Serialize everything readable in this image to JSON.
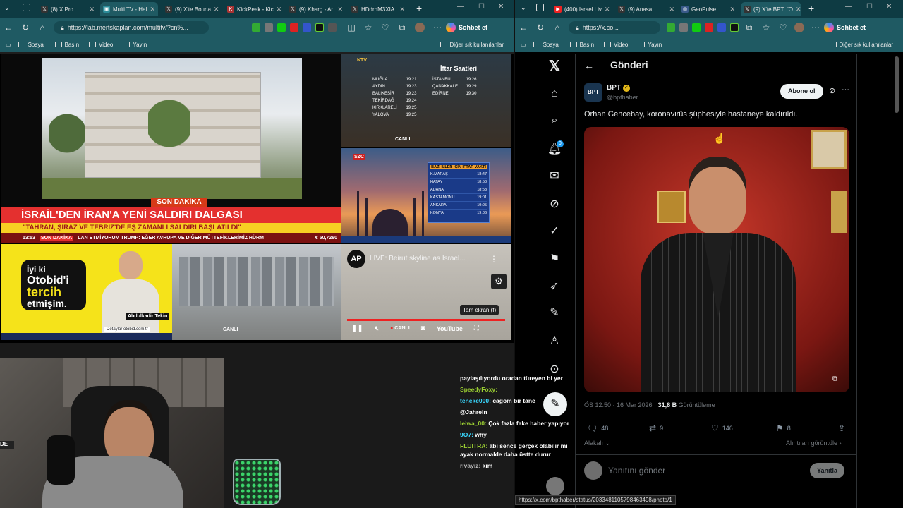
{
  "left_window": {
    "tabs": [
      {
        "label": "(8) X Pro",
        "active": false
      },
      {
        "label": "Multi TV - Hal",
        "active": true
      },
      {
        "label": "(9) X'te Bouna",
        "active": false
      },
      {
        "label": "KickPeek - Kic",
        "active": false
      },
      {
        "label": "(9) Kharg - Ar",
        "active": false
      },
      {
        "label": "HDdrhM3XIA",
        "active": false
      }
    ],
    "url": "https://lab.mertskaplan.com/multitv/?cn%...",
    "bookmarks": [
      "Sosyal",
      "Basın",
      "Video",
      "Yayın"
    ],
    "other_bookmarks": "Diğer sık kullanılanlar",
    "chat_button": "Sohbet et"
  },
  "right_window": {
    "tabs": [
      {
        "label": "(400) Israel Liv",
        "active": false
      },
      {
        "label": "(9) Anasa",
        "active": false
      },
      {
        "label": "GeoPulse",
        "active": false
      },
      {
        "label": "(9) X'te BPT: \"O",
        "active": true
      }
    ],
    "url": "https://x.co...",
    "bookmarks": [
      "Sosyal",
      "Basın",
      "Video",
      "Yayın"
    ],
    "other_bookmarks": "Diğer sık kullanılanlar",
    "chat_button": "Sohbet et",
    "status_url": "https://x.com/bpthaber/status/2033481105798463498/photo/1"
  },
  "tv": {
    "breaking_tag": "SON DAKİKA",
    "headline": "İSRAİL'DEN İRAN'A YENİ SALDIRI DALGASI",
    "subheadline": "\"TAHRAN, ŞİRAZ VE TEBRİZ'DE EŞ ZAMANLI SALDIRI BAŞLATILDI\"",
    "ticker_time": "13:53",
    "ticker_tag": "SON DAKİKA",
    "ticker_text": "LAN ETMİYORUM   TRUMP: EĞER AVRUPA VE DİĞER MÜTTEFİKLERİMİZ HÜRM",
    "ticker_value": "€ 50,7260",
    "iftar_title": "İftar Saatleri",
    "iftar_rows": [
      [
        "MUĞLA",
        "19:21",
        "İSTANBUL",
        "19:26"
      ],
      [
        "AYDIN",
        "19:23",
        "ÇANAKKALE",
        "19:29"
      ],
      [
        "BALIKESİR",
        "19:23",
        "EDİRNE",
        "19:30"
      ],
      [
        "TEKİRDAĞ",
        "19:24",
        "",
        ""
      ],
      [
        "KIRKLARELİ",
        "19:25",
        "",
        ""
      ],
      [
        "YALOVA",
        "19:25",
        "",
        ""
      ]
    ],
    "ntv_logo": "NTV",
    "szc_logo": "SZC",
    "szc_box_title": "BAZI İLLER İÇİN İFTAR VAKTİ",
    "szc_rows": [
      [
        "K.MARAŞ",
        "18:47"
      ],
      [
        "HATAY",
        "18:50"
      ],
      [
        "ADANA",
        "18:53"
      ],
      [
        "KASTAMONU",
        "19:01"
      ],
      [
        "ANKARA",
        "19:05"
      ],
      [
        "KONYA",
        "19:06"
      ]
    ],
    "ad_line1": "İyi ki",
    "ad_line2": "Otobid'i",
    "ad_line3": "tercih",
    "ad_line4": "etmişim.",
    "ad_name": "Abdulkadir Tekin",
    "ad_url": "Detaylar otobid.com.tr",
    "ap_logo": "AP",
    "ap_title": "LIVE: Beirut skyline as Israel...",
    "fullscreen_tip": "Tam ekran (f)",
    "canli": "CANLI"
  },
  "chat": [
    {
      "user": "",
      "text": "paylaşılıyordu oradan türeyen bi yer",
      "color": "#ffffff"
    },
    {
      "user": "SpeedyFoxy:",
      "text": "",
      "color": "#9acd32"
    },
    {
      "user": "teneke000:",
      "text": "cagom bir tane",
      "color": "#3ad8ff"
    },
    {
      "user": "",
      "text": "@Jahrein",
      "color": "#ffffff"
    },
    {
      "user": "leiwa_00:",
      "text": "Çok fazla fake haber yapıyor",
      "color": "#9acd32"
    },
    {
      "user": "9O7:",
      "text": "why",
      "color": "#3ad8ff"
    },
    {
      "user": "FLUITRA:",
      "text": "abi sence gerçek olabilir mi ayak normalde daha üstte durur",
      "color": "#9acd32"
    },
    {
      "user": "rivayiz:",
      "text": "kim",
      "color": "#bbbbbb"
    }
  ],
  "x": {
    "page_title": "Gönderi",
    "account_name": "BPT",
    "account_handle": "@bpthaber",
    "follow_label": "Abone ol",
    "post_text": "Orhan Gencebay, koronavirüs şüphesiyle hastaneye kaldırıldı.",
    "notification_count": "9",
    "post_time": "ÖS 12:50 · 16 Mar 2026 · ",
    "views_count": "31,8 B",
    "views_label": "Görüntüleme",
    "replies": "48",
    "reposts": "9",
    "likes": "146",
    "bookmarks": "8",
    "relevant_label": "Alakalı",
    "quotes_label": "Alıntıları görüntüle",
    "reply_placeholder": "Yanıtını gönder",
    "reply_button": "Yanıtla"
  },
  "colors": {
    "tab_bar": "#0e3b43",
    "toolbar": "#1f5a63",
    "breaking_red": "#e4302f",
    "headline_yellow": "#f7cf23",
    "x_bg": "#000000",
    "ad_yellow": "#f5e31a"
  }
}
